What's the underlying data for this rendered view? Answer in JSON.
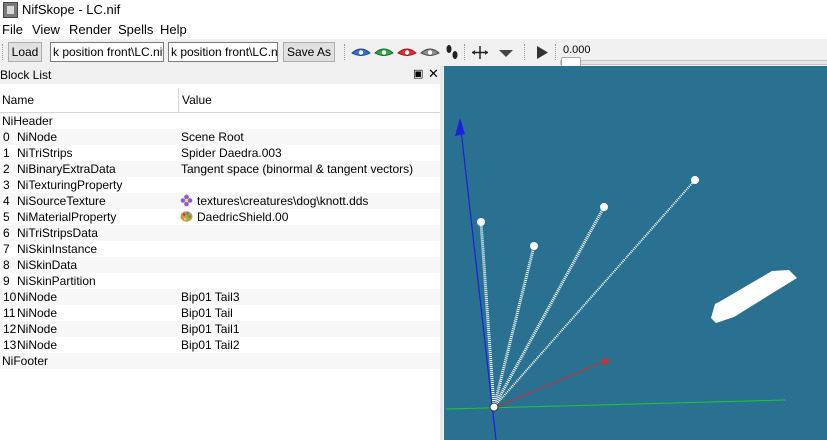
{
  "window": {
    "title": "NifSkope - LC.nif"
  },
  "menu": [
    "File",
    "View",
    "Render",
    "Spells",
    "Help"
  ],
  "toolbar": {
    "load_label": "Load",
    "load_path": "k position front\\LC.nif",
    "save_path": "k position front\\LC.nif",
    "save_as_label": "Save As",
    "time_value": "0.000"
  },
  "block_list": {
    "title": "Block List",
    "columns": [
      "Name",
      "Value"
    ],
    "header_row": "NiHeader",
    "rows": [
      {
        "index": "0",
        "type": "NiNode",
        "value": "Scene Root"
      },
      {
        "index": "1",
        "type": "NiTriStrips",
        "value": "Spider Daedra.003"
      },
      {
        "index": "2",
        "type": "NiBinaryExtraData",
        "value": "Tangent space (binormal & tangent vectors)"
      },
      {
        "index": "3",
        "type": "NiTexturingProperty",
        "value": ""
      },
      {
        "index": "4",
        "type": "NiSourceTexture",
        "value": "textures\\creatures\\dog\\knott.dds",
        "icon": "texture-flower-icon"
      },
      {
        "index": "5",
        "type": "NiMaterialProperty",
        "value": "DaedricShield.00",
        "icon": "palette-icon"
      },
      {
        "index": "6",
        "type": "NiTriStripsData",
        "value": ""
      },
      {
        "index": "7",
        "type": "NiSkinInstance",
        "value": ""
      },
      {
        "index": "8",
        "type": "NiSkinData",
        "value": ""
      },
      {
        "index": "9",
        "type": "NiSkinPartition",
        "value": ""
      },
      {
        "index": "10",
        "type": "NiNode",
        "value": "Bip01 Tail3"
      },
      {
        "index": "11",
        "type": "NiNode",
        "value": "Bip01 Tail"
      },
      {
        "index": "12",
        "type": "NiNode",
        "value": "Bip01 Tail1"
      },
      {
        "index": "13",
        "type": "NiNode",
        "value": "Bip01 Tail2"
      }
    ],
    "footer_row": "NiFooter"
  },
  "icons": {
    "app": "nifskope-app-icon",
    "view_eyes": [
      "eye-blue-icon",
      "eye-green-icon",
      "eye-red-icon",
      "eye-gray-icon"
    ],
    "walk": "footprints-icon",
    "move": "move-arrows-icon",
    "dropdown": "chevron-down-icon",
    "play": "play-icon"
  },
  "colors": {
    "viewport_bg": "#2a7090",
    "axis_x": "#c83232",
    "axis_y": "#1ec832",
    "axis_z": "#1e1ee0"
  }
}
